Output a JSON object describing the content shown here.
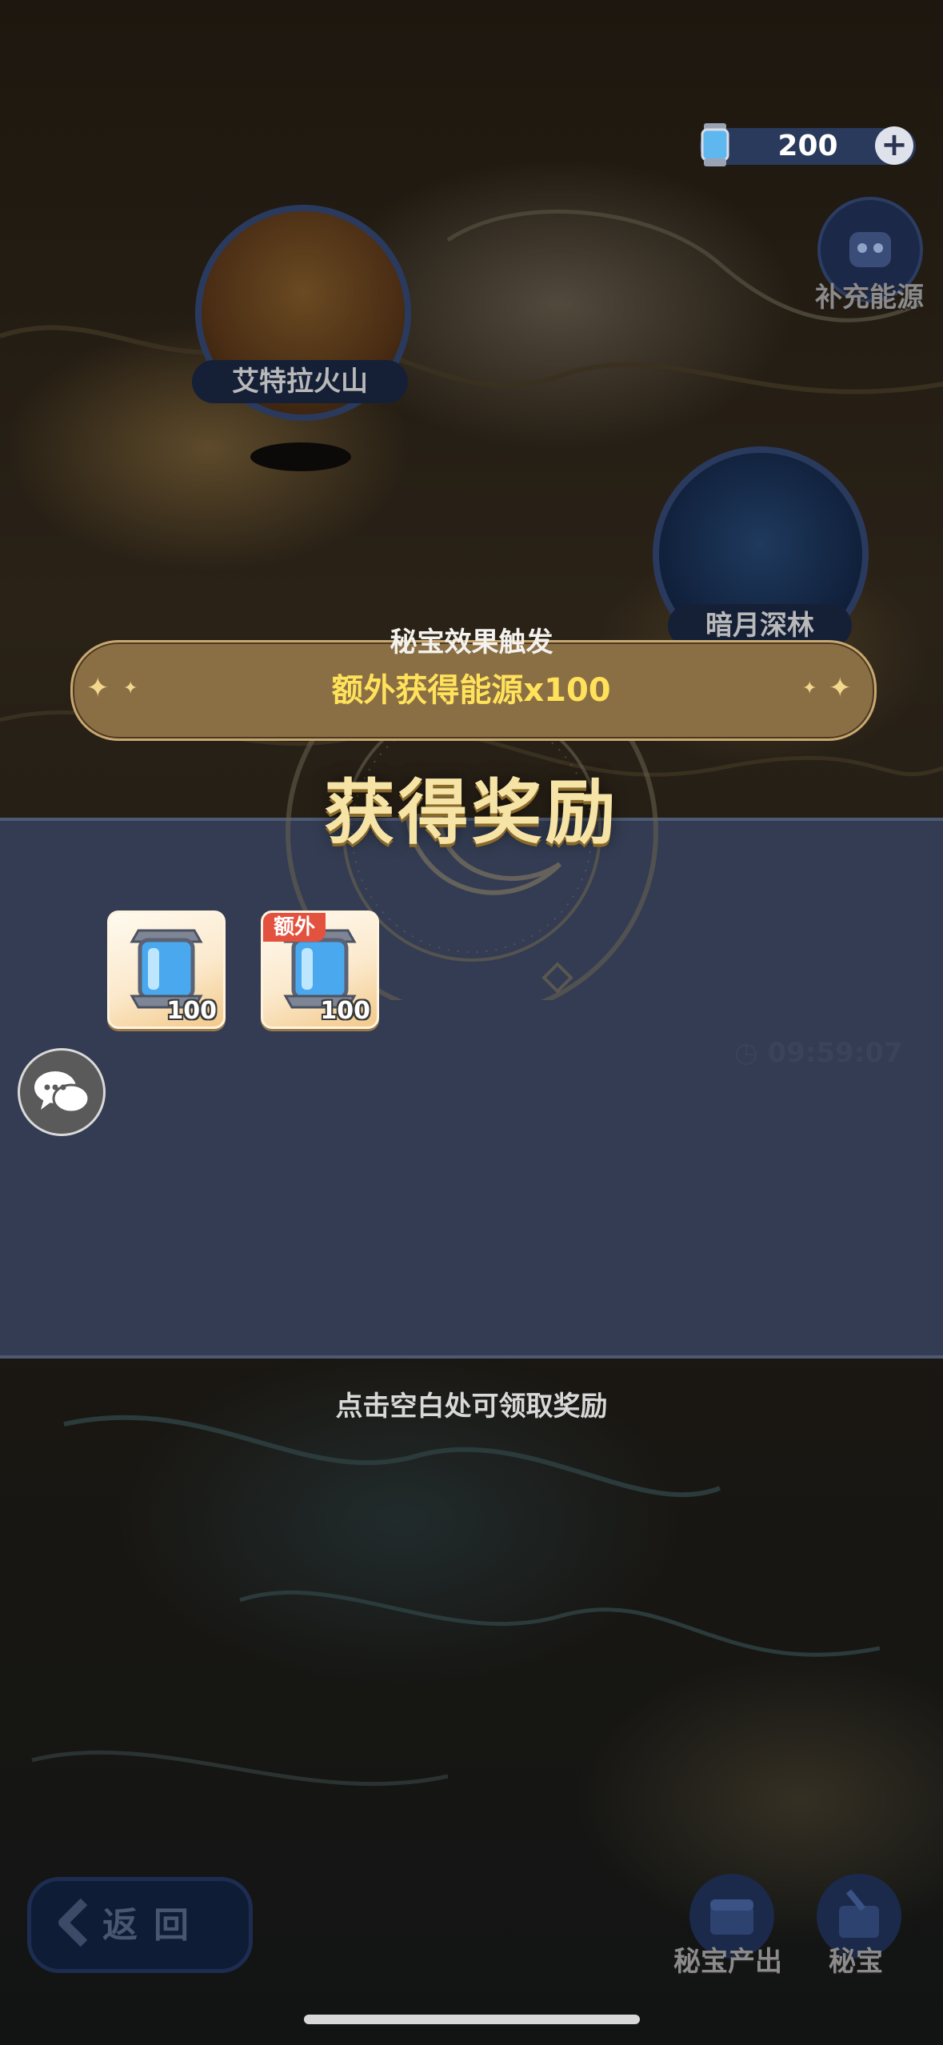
{
  "top_bar": {
    "energy_value": "200",
    "plus_label": "+",
    "refill_label": "补充能源"
  },
  "map_nodes": {
    "volcano_label": "艾特拉火山",
    "forest_label": "暗月深林"
  },
  "banner": {
    "title": "秘宝效果触发",
    "text": "额外获得能源x100"
  },
  "reward": {
    "title": "获得奖励",
    "items": [
      {
        "icon": "energy-canister-icon",
        "quantity": "100",
        "badge": ""
      },
      {
        "icon": "energy-canister-icon",
        "quantity": "100",
        "badge": "额外"
      }
    ],
    "timer": "09:59:07",
    "hint": "点击空白处可领取奖励"
  },
  "bottom": {
    "back_label": "返回",
    "treasure_output_label": "秘宝产出",
    "treasure_label": "秘宝"
  },
  "colors": {
    "banner_text": "#ffe25a",
    "reward_title": "#f6e3a6",
    "panel": "#333c52",
    "badge": "#e2523e"
  }
}
